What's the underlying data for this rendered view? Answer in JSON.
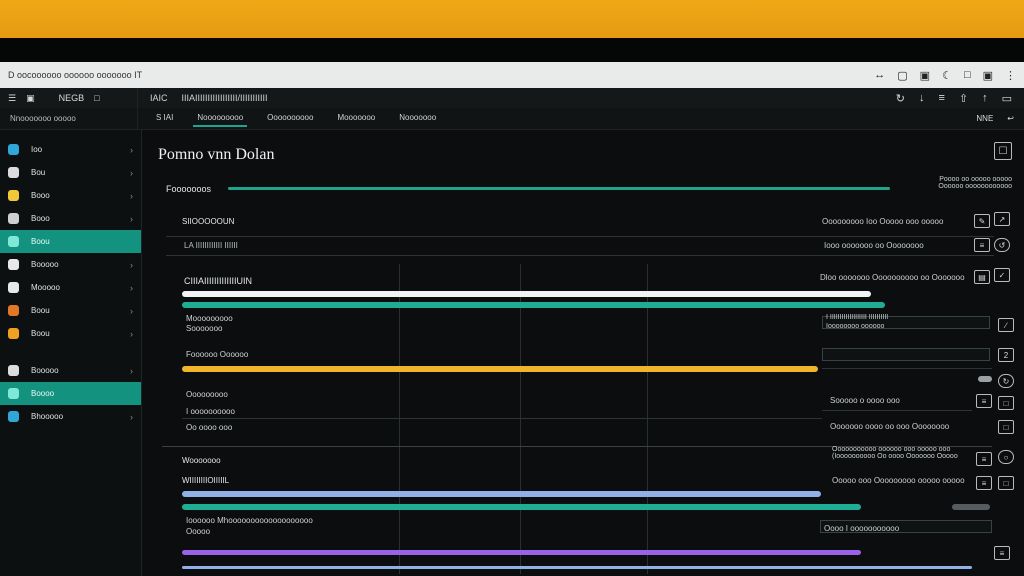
{
  "window": {
    "title": "D oocoooooo oooooo ooooooo IT",
    "right_icons": [
      "↔",
      "▢",
      "▣",
      "☾",
      "□",
      "▣",
      "⋮"
    ]
  },
  "app_bar": {
    "left_items": [
      "☰",
      "▣",
      "NEGB",
      "□"
    ],
    "crumbs": [
      "IAIC",
      "IIIAIIIIIIIIIIIIIIIII/IIIIIIIIIII"
    ],
    "icons": [
      "↻",
      "↓",
      "≡",
      "⇧",
      "↑",
      "▭"
    ]
  },
  "sub_bar": {
    "left_label": "Nnooooooo ooooo",
    "tabs": [
      "S IAI",
      "Nooooooooo",
      "Oooooooooo",
      "Mooooooo",
      "Nooooooo"
    ],
    "right": [
      "NNE",
      "↩"
    ]
  },
  "sidebar": {
    "items": [
      {
        "label": "Ioo",
        "color": "#2fa7d8"
      },
      {
        "label": "Bou",
        "color": "#dcdcdc"
      },
      {
        "label": "Booo",
        "color": "#f0c83a"
      },
      {
        "label": "Booo",
        "color": "#cfcfcf"
      },
      {
        "label": "Boou",
        "color": "#7fe8d6",
        "active": true
      },
      {
        "label": "Booooo",
        "color": "#e8e8e8"
      },
      {
        "label": "Mooooo",
        "color": "#e8e8e8"
      },
      {
        "label": "Boou",
        "color": "#e07828"
      },
      {
        "label": "Boou",
        "color": "#f0a020"
      },
      {
        "label": "Booooo",
        "color": "#dcdcdc"
      },
      {
        "label": "Boooo",
        "color": "#7fe8d6",
        "active": true
      },
      {
        "label": "Bhooooo",
        "color": "#2fa7d8"
      }
    ]
  },
  "main": {
    "title": "Pomno vnn Dolan",
    "close_icon": "☐",
    "section1": {
      "label": "Fooooooos",
      "progress": 0.92,
      "right_note": [
        "Poooo oo ooooo ooooo",
        "Oooooo oooooooooooo"
      ]
    },
    "rows": [
      {
        "label": "SIIOOOOOUN",
        "sub": "LA IIIIIIIIIIII IIIIII",
        "right": "Ooooooooo Ioo Ooooo ooo ooooo",
        "right_sub": "Iooo ooooooo oo Oooooooo"
      },
      {
        "label": "CIIIAIIIIIIIIIIIIIUIN",
        "right": "Dloo ooooooo Oooooooooo oo Ooooooo"
      }
    ],
    "bars_block1": {
      "white_progress": 0.84,
      "teal_progress": 0.89,
      "label_a": "Mooooooooo",
      "label_a2": "Sooooooo",
      "right_a": "I IIIIIIIIIIIIIIIIIII IIIIIIIIII",
      "right_a2": "Ioooooooo oooooo"
    },
    "bars_block2": {
      "label": "Foooooo Oooooo",
      "orange_progress": 0.74,
      "label_b": "Ooooooooo",
      "label_b2": "I oooooooooo",
      "label_b3": "Oo oooo ooo",
      "right_b": "Sooooo o oooo ooo",
      "right_b2": "Ooooooo oooo oo ooo Oooooooo"
    },
    "section2": {
      "label": "Wooooooo",
      "sub": "WIIIIIIIIOIIIIIL",
      "right_a": "Ooooooooooo oooooo ooo ooooo ooo",
      "right_a2": "(Ioooooooooo Oo oooo Ooooooo Ooooo",
      "right_b": "Ooooo ooo Ooooooooo ooooo ooooo",
      "blue_progress": 0.83,
      "teal_progress": 0.86,
      "label_c": "Ioooooo Mhooooooooooooooooooo",
      "label_c2": "Ooooo",
      "right_c": "Oooo I ooooooooooo",
      "purple_progress": 0.86
    }
  }
}
